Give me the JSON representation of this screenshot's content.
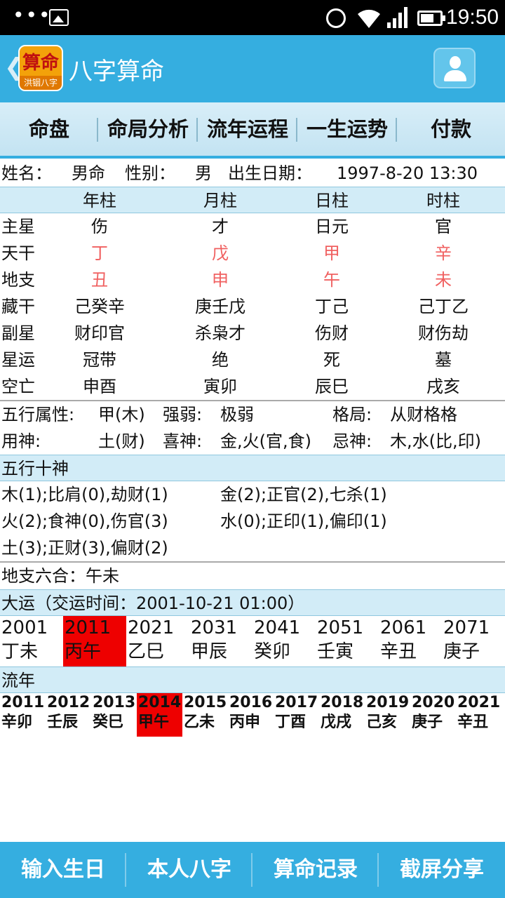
{
  "status_bar": {
    "time": "19:50",
    "dots": "•••",
    "icons": [
      "gallery-icon",
      "alarm-icon",
      "wifi-icon",
      "signal-icon",
      "battery-icon"
    ]
  },
  "app_bar": {
    "logo_big": "算命",
    "logo_small": "洪铟八字",
    "title": "八字算命",
    "back": "❮"
  },
  "tabs": [
    "命盘",
    "命局分析",
    "流年运程",
    "一生运势",
    "付款"
  ],
  "info": {
    "name_label": "姓名：",
    "name_value": "男命",
    "gender_label": "性别：",
    "gender_value": "男",
    "birth_label": "出生日期：",
    "birth_value": "1997-8-20 13:30"
  },
  "pillars": {
    "headers": [
      "年柱",
      "月柱",
      "日柱",
      "时柱"
    ],
    "rows": [
      {
        "label": "主星",
        "values": [
          "伤",
          "才",
          "日元",
          "官"
        ],
        "red": false
      },
      {
        "label": "天干",
        "values": [
          "丁",
          "戊",
          "甲",
          "辛"
        ],
        "red": true
      },
      {
        "label": "地支",
        "values": [
          "丑",
          "申",
          "午",
          "未"
        ],
        "red": true
      },
      {
        "label": "藏干",
        "values": [
          "己癸辛",
          "庚壬戊",
          "丁己",
          "己丁乙"
        ],
        "red": false
      },
      {
        "label": "副星",
        "values": [
          "财印官",
          "杀枭才",
          "伤财",
          "财伤劫"
        ],
        "red": false
      },
      {
        "label": "星运",
        "values": [
          "冠带",
          "绝",
          "死",
          "墓"
        ],
        "red": false
      },
      {
        "label": "空亡",
        "values": [
          "申酉",
          "寅卯",
          "辰巳",
          "戌亥"
        ],
        "red": false
      }
    ]
  },
  "attributes": {
    "wuxing_label": "五行属性:",
    "wuxing_value": "甲(木)",
    "strength_label": "强弱:",
    "strength_value": "极弱",
    "geju_label": "格局:",
    "geju_value": "从财格格",
    "yongshen_label": "用神:",
    "yongshen_value": "土(财)",
    "xishen_label": "喜神:",
    "xishen_value": "金,火(官,食)",
    "jishen_label": "忌神:",
    "jishen_value": "木,水(比,印)"
  },
  "wuxing_shishen": {
    "title": "五行十神",
    "lines": [
      [
        "木(1);比肩(0),劫财(1)",
        "金(2);正官(2),七杀(1)"
      ],
      [
        "火(2);食神(0),伤官(3)",
        "水(0);正印(1),偏印(1)"
      ],
      [
        "土(3);正财(3),偏财(2)",
        ""
      ]
    ]
  },
  "liuhe": "地支六合：午未",
  "dayun": {
    "title": "大运（交运时间：2001-10-21 01:00）",
    "active_index": 1,
    "items": [
      {
        "year": "2001",
        "gz": "丁未"
      },
      {
        "year": "2011",
        "gz": "丙午"
      },
      {
        "year": "2021",
        "gz": "乙巳"
      },
      {
        "year": "2031",
        "gz": "甲辰"
      },
      {
        "year": "2041",
        "gz": "癸卯"
      },
      {
        "year": "2051",
        "gz": "壬寅"
      },
      {
        "year": "2061",
        "gz": "辛丑"
      },
      {
        "year": "2071",
        "gz": "庚子"
      }
    ]
  },
  "liunian": {
    "title": "流年",
    "active_index": 3,
    "items": [
      {
        "year": "2011",
        "gz": "辛卯"
      },
      {
        "year": "2012",
        "gz": "壬辰"
      },
      {
        "year": "2013",
        "gz": "癸巳"
      },
      {
        "year": "2014",
        "gz": "甲午"
      },
      {
        "year": "2015",
        "gz": "乙未"
      },
      {
        "year": "2016",
        "gz": "丙申"
      },
      {
        "year": "2017",
        "gz": "丁酉"
      },
      {
        "year": "2018",
        "gz": "戊戌"
      },
      {
        "year": "2019",
        "gz": "己亥"
      },
      {
        "year": "2020",
        "gz": "庚子"
      },
      {
        "year": "2021",
        "gz": "辛丑"
      }
    ]
  },
  "bottom_bar": [
    "输入生日",
    "本人八字",
    "算命记录",
    "截屏分享"
  ],
  "colors": {
    "primary": "#35aee0",
    "header_bg": "#d2ecf7",
    "highlight": "#ee0000",
    "red_text": "#f06060"
  }
}
